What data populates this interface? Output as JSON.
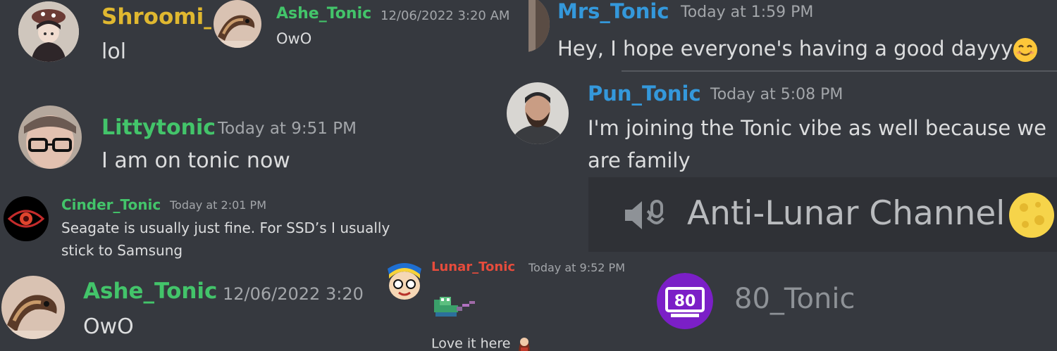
{
  "messages": {
    "shroomi": {
      "author": "Shroomi_",
      "text": "lol",
      "color": "#e0b830"
    },
    "ashe_small": {
      "author": "Ashe_Tonic",
      "timestamp": "12/06/2022 3:20 AM",
      "text": "OwO",
      "color": "#43c46a"
    },
    "mrs": {
      "author": "Mrs_Tonic",
      "timestamp": "Today at 1:59 PM",
      "text": "Hey, I hope everyone's having a good dayyy",
      "emoji": "smiling-face",
      "color": "#3498db"
    },
    "pun": {
      "author": "Pun_Tonic",
      "timestamp": "Today at 5:08 PM",
      "text_line1": "I'm joining the Tonic vibe as well because we",
      "text_line2": "are family",
      "color": "#3498db"
    },
    "litty": {
      "author": "Littytonic",
      "timestamp": "Today at 9:51 PM",
      "text": "I am on tonic now",
      "color": "#43c46a"
    },
    "cinder": {
      "author": "Cinder_Tonic",
      "timestamp": "Today at 2:01 PM",
      "text_line1": "Seagate is usually just fine. For SSD’s I usually",
      "text_line2": "stick to Samsung",
      "color": "#43c46a"
    },
    "ashe_large": {
      "author": "Ashe_Tonic",
      "timestamp": "12/06/2022 3:20",
      "text": "OwO",
      "color": "#43c46a"
    },
    "lunar": {
      "author": "Lunar_Tonic",
      "timestamp": "Today at 9:52 PM",
      "sticker": "pepe-frog-pixel-sticker",
      "text": "Love it here",
      "color": "#e74c3c"
    }
  },
  "voice_channel": {
    "name": "Anti-Lunar Channel",
    "icon": "voice-speaker-icon",
    "emoji": "full-moon"
  },
  "member": {
    "name": "80_Tonic",
    "avatar_text": "80"
  }
}
